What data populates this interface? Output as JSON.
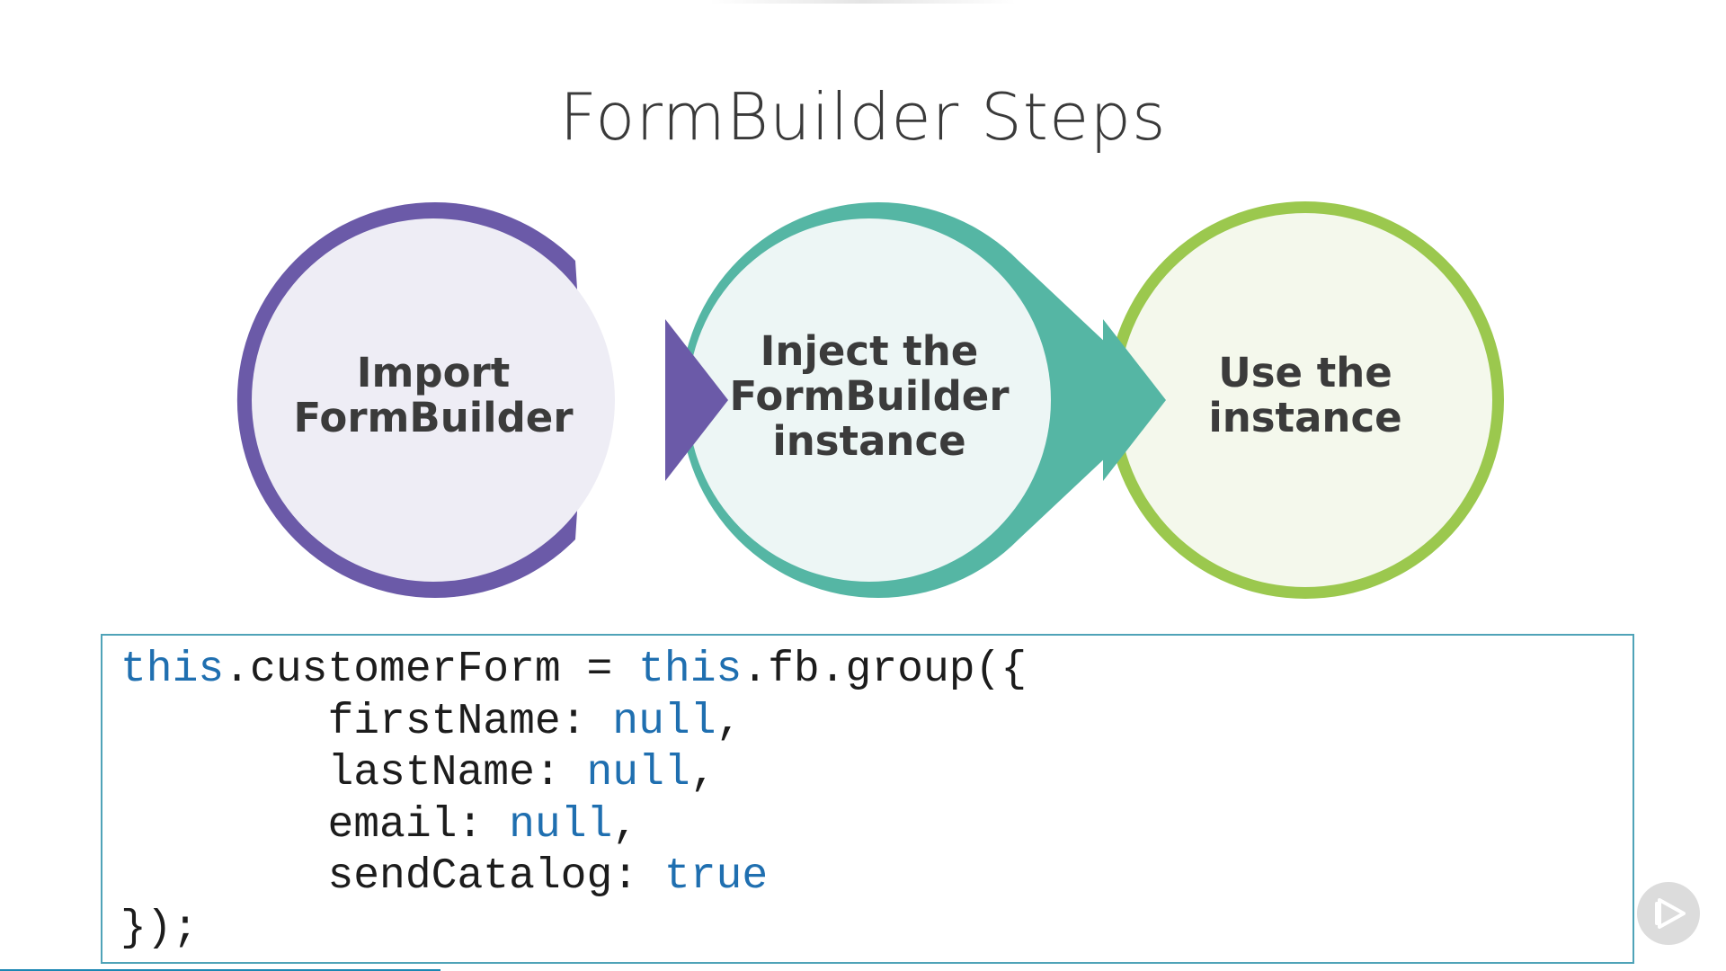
{
  "slide": {
    "title": "FormBuilder Steps"
  },
  "steps": [
    {
      "lines": [
        "Import",
        "FormBuilder"
      ],
      "color": "#6b5aa8",
      "fill": "#eeedf5"
    },
    {
      "lines": [
        "Inject the",
        "FormBuilder",
        "instance"
      ],
      "color": "#55b6a4",
      "fill": "#edf6f5"
    },
    {
      "lines": [
        "Use the",
        "instance"
      ],
      "color": "#9bc84e",
      "fill": "#f4f8ec"
    }
  ],
  "code": {
    "line1": {
      "kw1": "this",
      "t1": ".customerForm = ",
      "kw2": "this",
      "t2": ".fb.group({"
    },
    "line2": {
      "t1": "        firstName: ",
      "kw1": "null",
      "t2": ","
    },
    "line3": {
      "t1": "        lastName: ",
      "kw1": "null",
      "t2": ","
    },
    "line4": {
      "t1": "        email: ",
      "kw1": "null",
      "t2": ","
    },
    "line5": {
      "t1": "        sendCatalog: ",
      "kw1": "true"
    },
    "line6": {
      "t1": "});"
    }
  },
  "player": {
    "progress": 0.255,
    "play_icon": "play-icon"
  }
}
